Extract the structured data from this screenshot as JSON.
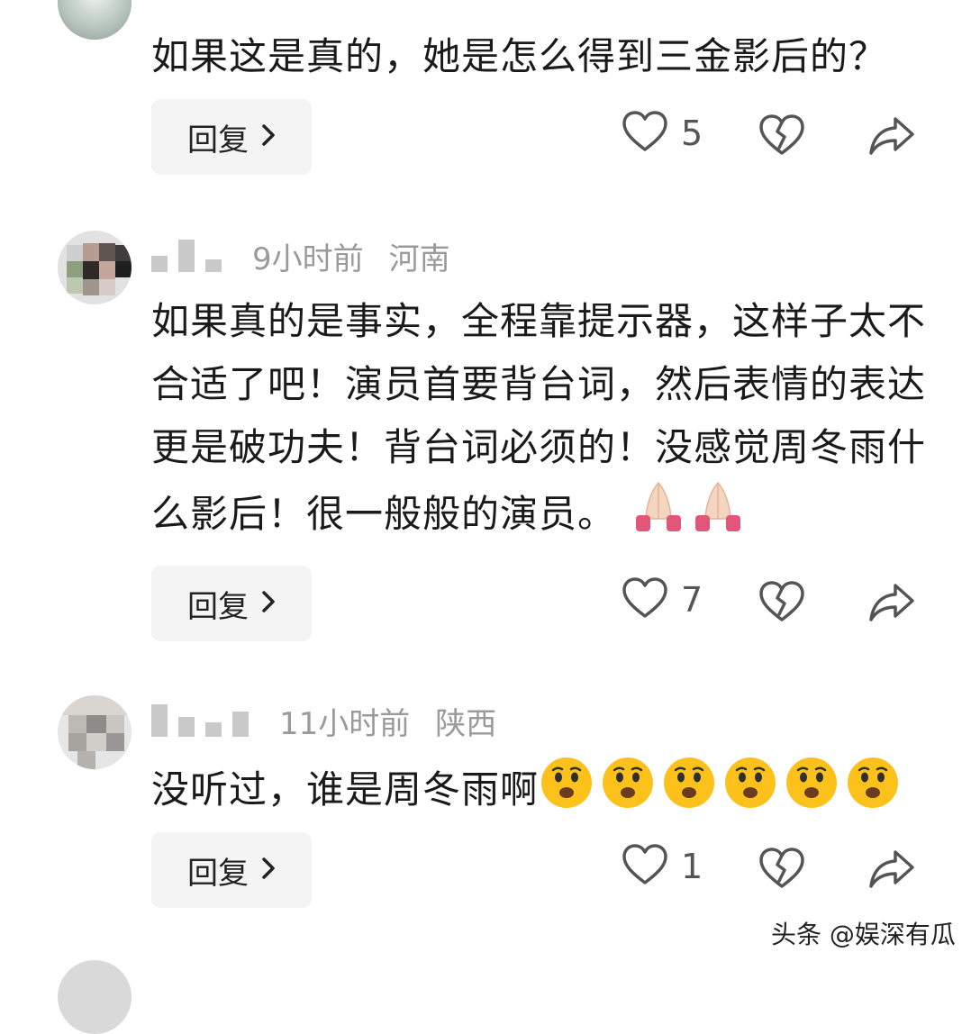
{
  "comments": [
    {
      "meta": {
        "time": "",
        "location": ""
      },
      "text": "如果这是真的，她是怎么得到三金影后的？",
      "emojis": [],
      "reply_label": "回复",
      "likes": "5"
    },
    {
      "meta": {
        "time": "9小时前",
        "location": "河南"
      },
      "text": "如果真的是事实，全程靠提示器，这样子太不合适了吧！演员首要背台词，然后表情的表达更是破功夫！背台词必须的！没感觉周冬雨什么影后！很一般般的演员。",
      "emojis": [
        "folded-hands",
        "folded-hands"
      ],
      "reply_label": "回复",
      "likes": "7"
    },
    {
      "meta": {
        "time": "11小时前",
        "location": "陕西"
      },
      "text": "没听过，谁是周冬雨啊",
      "emojis": [
        "frowning-face",
        "frowning-face",
        "frowning-face",
        "frowning-face",
        "frowning-face",
        "frowning-face"
      ],
      "reply_label": "回复",
      "likes": "1"
    }
  ],
  "icons": {
    "like": "heart-outline-icon",
    "dislike": "broken-heart-icon",
    "share": "share-arrow-icon",
    "reply_chevron": "chevron-right-icon"
  },
  "colors": {
    "text": "#1a1a1a",
    "meta": "#9a9a9a",
    "icon": "#555555",
    "reply_bg": "#f4f4f4"
  },
  "watermark": "头条 @娱深有瓜"
}
